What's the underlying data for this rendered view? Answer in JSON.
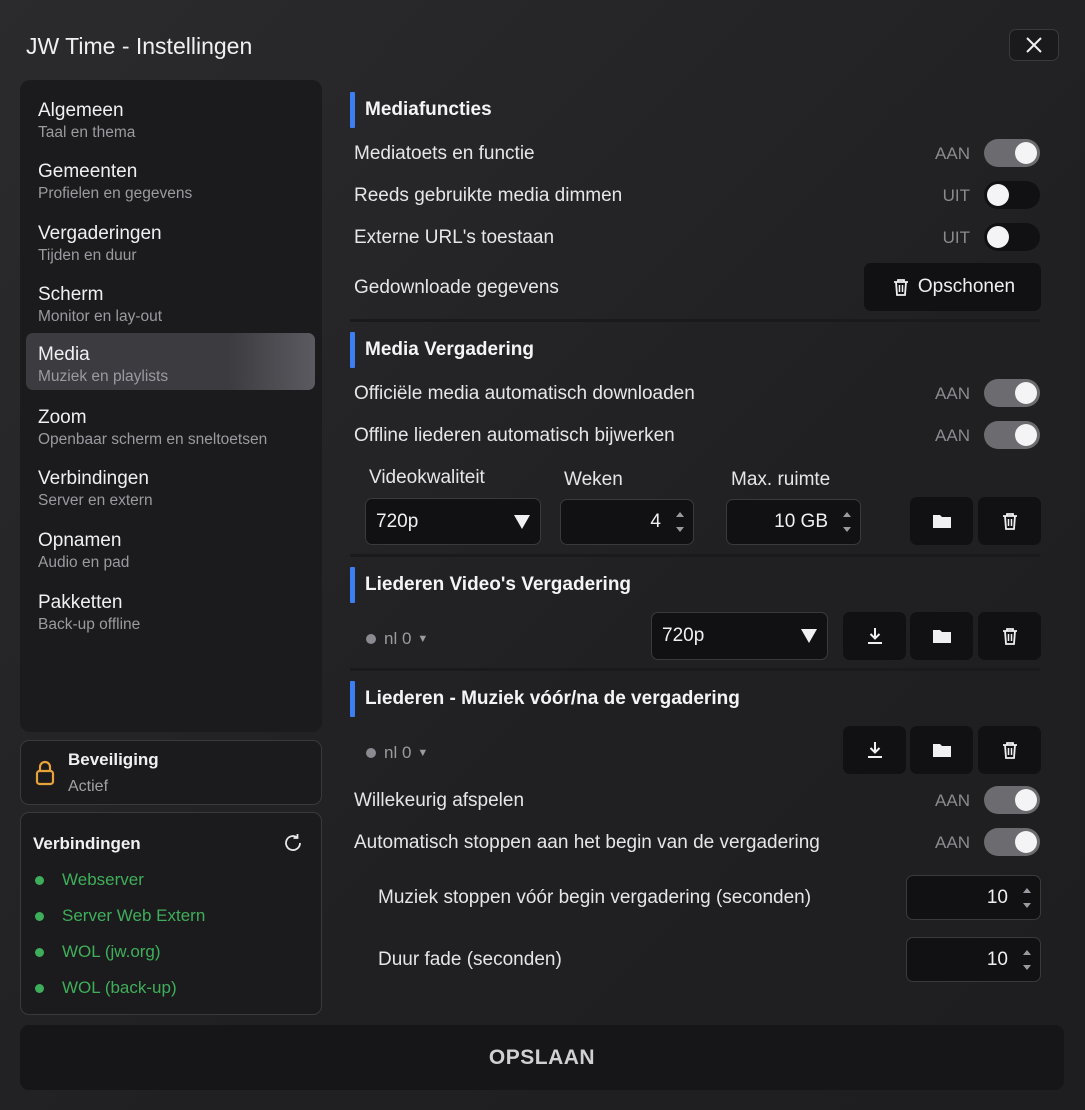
{
  "window": {
    "title": "JW Time - Instellingen"
  },
  "sidebar": {
    "items": [
      {
        "label": "Algemeen",
        "sub": "Taal en thema"
      },
      {
        "label": "Gemeenten",
        "sub": "Profielen en gegevens"
      },
      {
        "label": "Vergaderingen",
        "sub": "Tijden en duur"
      },
      {
        "label": "Scherm",
        "sub": "Monitor en lay-out"
      },
      {
        "label": "Media",
        "sub": "Muziek en playlists"
      },
      {
        "label": "Zoom",
        "sub": "Openbaar scherm en sneltoetsen"
      },
      {
        "label": "Verbindingen",
        "sub": "Server en extern"
      },
      {
        "label": "Opnamen",
        "sub": "Audio en pad"
      },
      {
        "label": "Pakketten",
        "sub": "Back-up offline"
      }
    ],
    "active_index": 4
  },
  "security": {
    "title": "Beveiliging",
    "status": "Actief"
  },
  "connections": {
    "title": "Verbindingen",
    "items": [
      "Webserver",
      "Server Web Extern",
      "WOL (jw.org)",
      "WOL (back-up)"
    ],
    "status_color": "#3fae5a"
  },
  "media_functions": {
    "title": "Mediafuncties",
    "rows": [
      {
        "label": "Mediatoets en functie",
        "state": "AAN"
      },
      {
        "label": "Reeds gebruikte media dimmen",
        "state": "UIT"
      },
      {
        "label": "Externe URL's toestaan",
        "state": "UIT"
      }
    ],
    "downloaded_label": "Gedownloade gegevens",
    "cleanup_label": "Opschonen"
  },
  "media_meeting": {
    "title": "Media Vergadering",
    "rows": [
      {
        "label": "Officiële media automatisch downloaden",
        "state": "AAN"
      },
      {
        "label": "Offline liederen automatisch bijwerken",
        "state": "AAN"
      }
    ],
    "video_quality_label": "Videokwaliteit",
    "video_quality_value": "720p",
    "weeks_label": "Weken",
    "weeks_value": "4",
    "max_space_label": "Max. ruimte",
    "max_space_value": "10 GB"
  },
  "songs_video": {
    "title": "Liederen Video's Vergadering",
    "lang": "nl 0",
    "quality_value": "720p"
  },
  "songs_music": {
    "title": "Liederen - Muziek vóór/na de vergadering",
    "lang": "nl 0",
    "rows": [
      {
        "label": "Willekeurig afspelen",
        "state": "AAN"
      },
      {
        "label": "Automatisch stoppen aan het begin van de vergadering",
        "state": "AAN"
      }
    ],
    "stop_before_label": "Muziek stoppen vóór begin vergadering (seconden)",
    "stop_before_value": "10",
    "fade_label": "Duur fade (seconden)",
    "fade_value": "10"
  },
  "footer": {
    "save_label": "OPSLAAN"
  },
  "colors": {
    "accent": "#3d7ff0",
    "toggle_on": "#6b6b70",
    "toggle_off": "#111113"
  }
}
